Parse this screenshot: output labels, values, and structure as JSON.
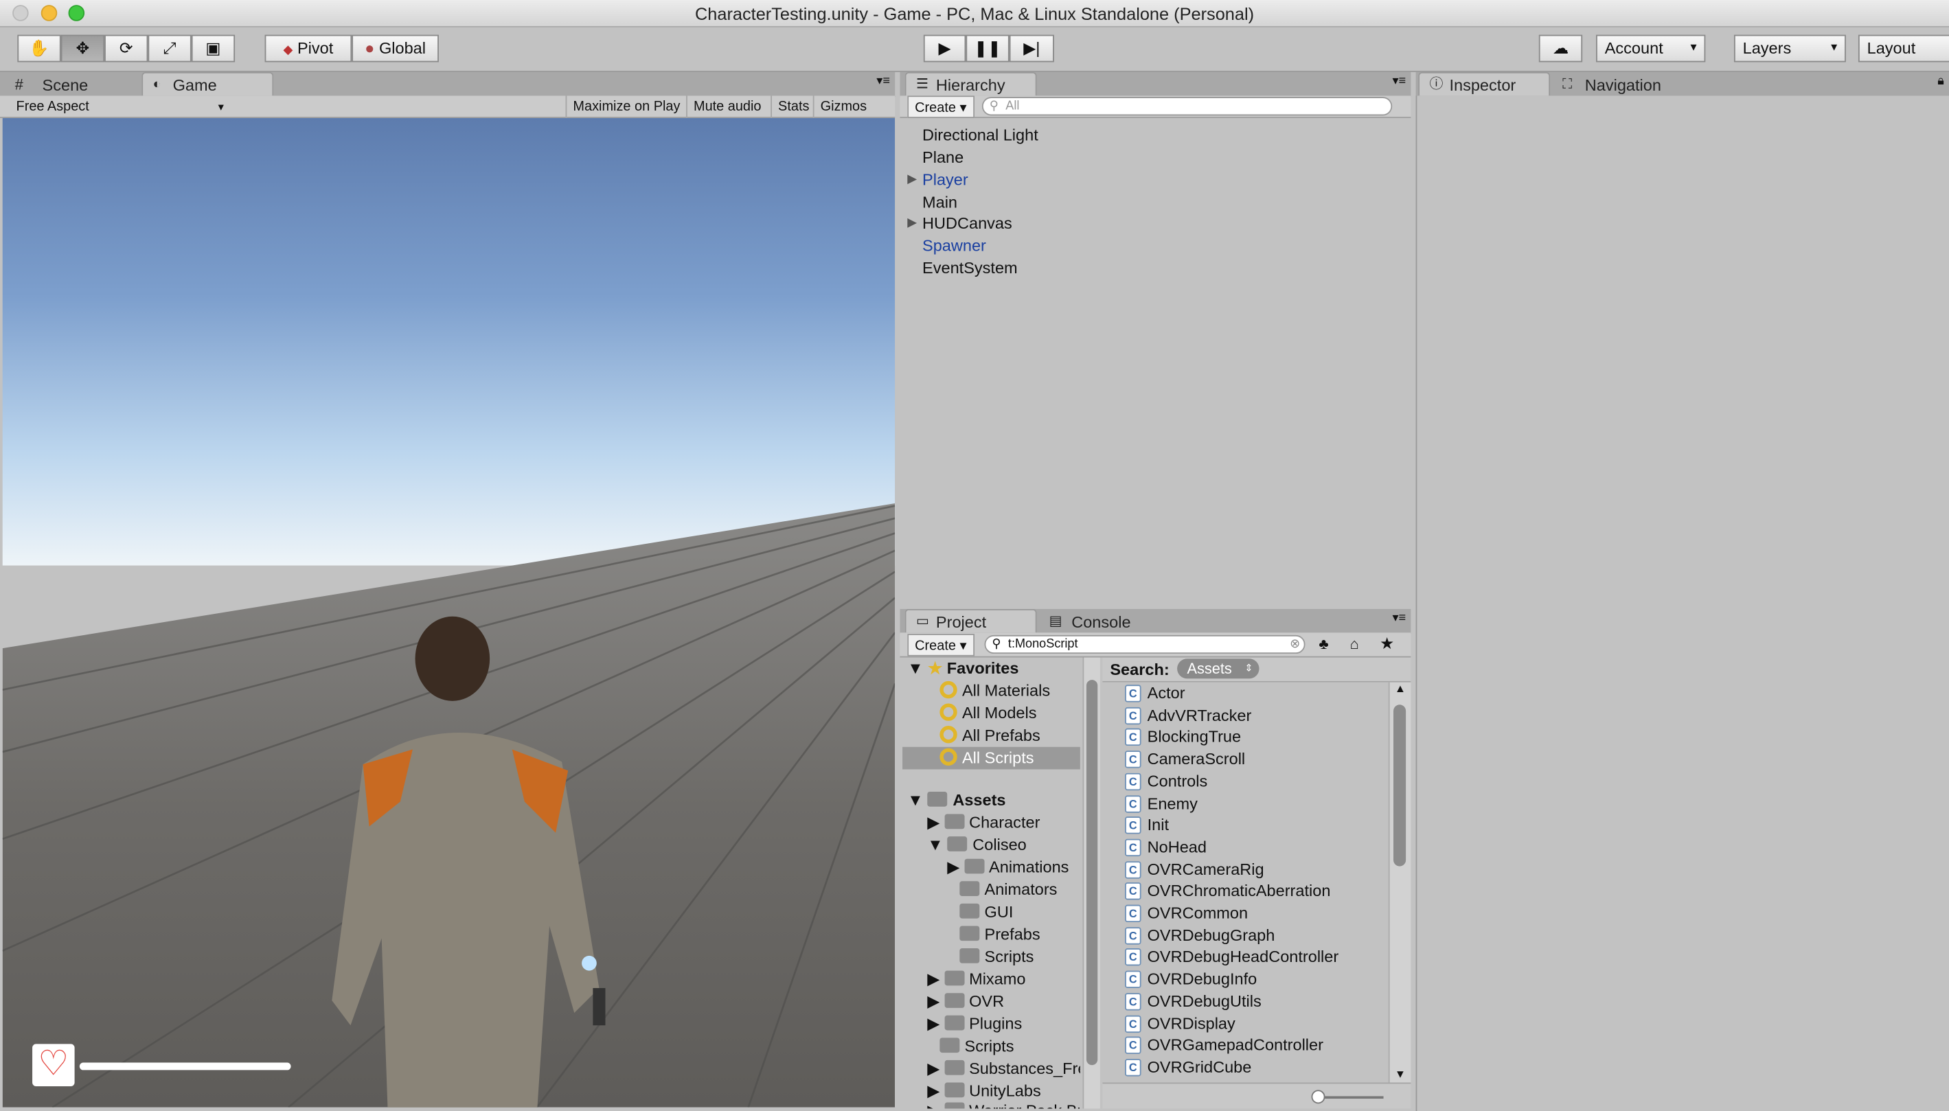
{
  "window": {
    "title": "CharacterTesting.unity - Game - PC, Mac & Linux Standalone (Personal)"
  },
  "toolbar": {
    "pivot": "Pivot",
    "global": "Global",
    "account": "Account",
    "layers": "Layers",
    "layout": "Layout"
  },
  "left_panel": {
    "tabs": [
      "Scene",
      "Game"
    ],
    "aspect": "Free Aspect",
    "maximize": "Maximize on Play",
    "mute": "Mute audio",
    "stats": "Stats",
    "gizmos": "Gizmos"
  },
  "hierarchy": {
    "tab": "Hierarchy",
    "create": "Create",
    "search_placeholder": "All",
    "items": [
      "Directional Light",
      "Plane",
      "Player",
      "Main",
      "HUDCanvas",
      "Spawner",
      "EventSystem"
    ]
  },
  "inspector": {
    "tab": "Inspector",
    "nav_tab": "Navigation"
  },
  "project": {
    "tab": "Project",
    "console_tab": "Console",
    "create": "Create",
    "search_value": "t:MonoScript",
    "search_label": "Search:",
    "search_scope": "Assets",
    "favorites_label": "Favorites",
    "favorites": [
      "All Materials",
      "All Models",
      "All Prefabs",
      "All Scripts"
    ],
    "assets_label": "Assets",
    "tree": [
      "Character",
      "Coliseo",
      "Animations",
      "Animators",
      "GUI",
      "Prefabs",
      "Scripts",
      "Mixamo",
      "OVR",
      "Plugins",
      "Scripts",
      "Substances_Fre",
      "UnityLabs",
      "Warrior Pack Bu"
    ],
    "scripts": [
      "Actor",
      "AdvVRTracker",
      "BlockingTrue",
      "CameraScroll",
      "Controls",
      "Enemy",
      "Init",
      "NoHead",
      "OVRCameraRig",
      "OVRChromaticAberration",
      "OVRCommon",
      "OVRDebugGraph",
      "OVRDebugHeadController",
      "OVRDebugInfo",
      "OVRDebugUtils",
      "OVRDisplay",
      "OVRGamepadController",
      "OVRGridCube"
    ]
  },
  "colors": {
    "selected_blue": "#1a3fa0",
    "sky_top": "#6080b0",
    "floor": "#6e6c69"
  }
}
